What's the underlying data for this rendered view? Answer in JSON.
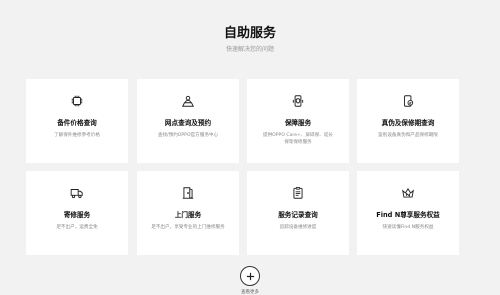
{
  "header": {
    "title": "自助服务",
    "subtitle": "快速解决您的问题"
  },
  "services": [
    {
      "icon": "chip-icon",
      "title": "备件价格查询",
      "desc": "了解保外维修参考价格"
    },
    {
      "icon": "location-person-icon",
      "title": "网点查询及预约",
      "desc": "查找/预约OPPO官方服务中心"
    },
    {
      "icon": "phone-shield-icon",
      "title": "保障服务",
      "desc": "提供OPPO Care+、屏碎保、延长保等保修服务"
    },
    {
      "icon": "phone-check-icon",
      "title": "真伪及保修期查询",
      "desc": "鉴别设备真伪和产品保修期限"
    },
    {
      "icon": "truck-icon",
      "title": "寄修服务",
      "desc": "足不出户，运费全免"
    },
    {
      "icon": "door-icon",
      "title": "上门服务",
      "desc": "足不出户，享受专业的上门维修服务"
    },
    {
      "icon": "clipboard-icon",
      "title": "服务记录查询",
      "desc": "追踪设备维修进度"
    },
    {
      "icon": "crown-n-icon",
      "title": "Find N尊享服务权益",
      "desc": "快速读懂Find N服务权益"
    }
  ],
  "more": {
    "label": "查看更多"
  }
}
